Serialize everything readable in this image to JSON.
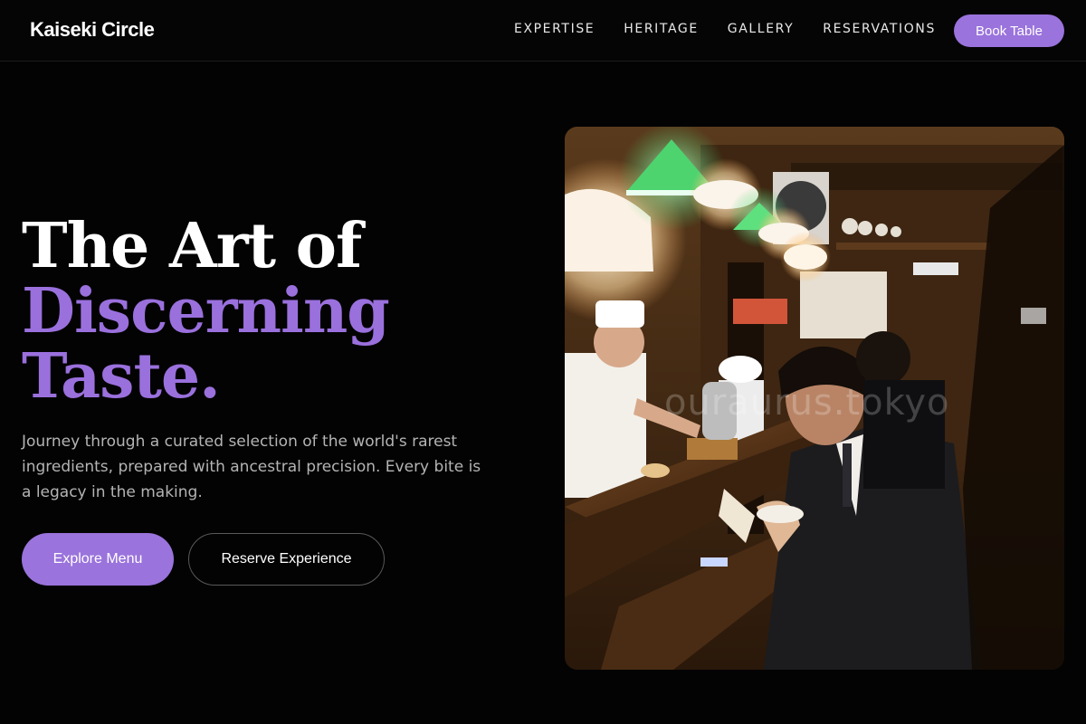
{
  "brand": {
    "name": "Kaiseki Circle"
  },
  "nav": {
    "links": [
      "EXPERTISE",
      "HERITAGE",
      "GALLERY",
      "RESERVATIONS"
    ],
    "cta": "Book Table"
  },
  "hero": {
    "title_line1": "The Art of",
    "title_line2": "Discerning",
    "title_line3": "Taste.",
    "subtitle": "Journey through a curated selection of the world's rarest ingredients, prepared with ancestral precision. Every bite is a legacy in the making.",
    "primary_button": "Explore Menu",
    "secondary_button": "Reserve Experience"
  },
  "photo": {
    "alt": "Chefs and diners at a dimly lit Japanese counter restaurant",
    "watermark": "ouraurus.tokyo"
  },
  "colors": {
    "accent": "#9a73dc",
    "background": "#030303",
    "text_muted": "#b4b4b4"
  }
}
